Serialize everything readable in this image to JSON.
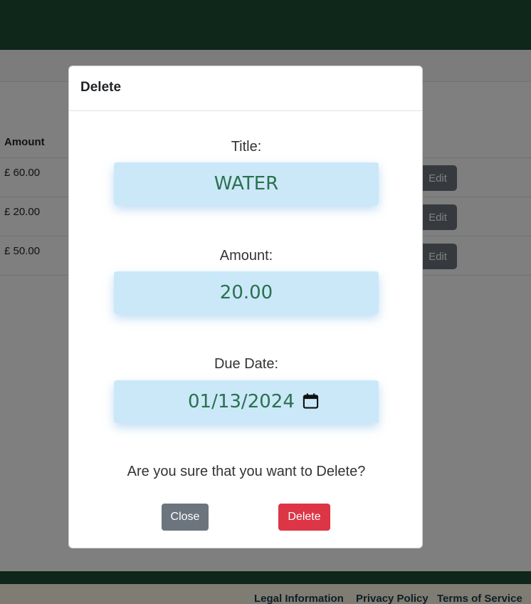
{
  "background": {
    "table_header_amount": "Amount",
    "rows": [
      {
        "amount": "£ 60.00",
        "edit_label": "Edit"
      },
      {
        "amount": "£ 20.00",
        "edit_label": "Edit"
      },
      {
        "amount": "£ 50.00",
        "edit_label": "Edit"
      }
    ],
    "footer_links": [
      "Legal Information",
      "Privacy Policy",
      "Terms of Service"
    ]
  },
  "modal": {
    "title": "Delete",
    "title_label": "Title:",
    "title_value": "WATER",
    "amount_label": "Amount:",
    "amount_value": "20.00",
    "due_date_label": "Due Date:",
    "due_date_value": "01/13/2024",
    "confirm_text": "Are you sure that you want to Delete?",
    "close_label": "Close",
    "delete_label": "Delete"
  },
  "colors": {
    "header_green": "#1f4d35",
    "field_bg": "#cbe8f8",
    "field_text": "#2a7150",
    "delete_red": "#dc3545",
    "close_gray": "#6c757d"
  },
  "icons": {
    "date_picker": "calendar-icon"
  }
}
